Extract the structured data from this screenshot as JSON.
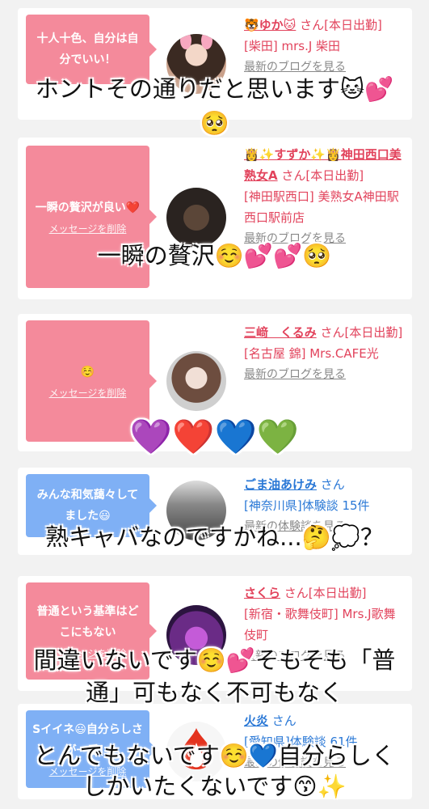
{
  "cards": [
    {
      "message": "十人十色、自分は自分でいい！",
      "bubble_color": "pink",
      "delete_label": "メッセージを削除",
      "name": "🐯ゆか🐱",
      "suffix": "さん[本日出勤]",
      "place": "[柴田] mrs.J 柴田",
      "blog_link": "最新のブログを見る",
      "name_color": "pink"
    },
    {
      "message": "一瞬の贅沢が良い❤️",
      "bubble_color": "pink",
      "delete_label": "メッセージを削除",
      "name": "👸✨すずか✨👸神田西口美熟女A",
      "suffix": "さん[本日出勤]",
      "place": "[神田駅西口] 美熟女A神田駅西口駅前店",
      "blog_link": "最新のブログを見る",
      "name_color": "pink"
    },
    {
      "message": "☺️",
      "bubble_color": "pink",
      "delete_label": "メッセージを削除",
      "name": "三﨑　くるみ",
      "suffix": "さん[本日出勤]",
      "place": "[名古屋 錦] Mrs.CAFE光",
      "blog_link": "最新のブログを見る",
      "name_color": "pink"
    },
    {
      "message": "みんな和気藹々してました😃",
      "bubble_color": "blue",
      "delete_label": "",
      "name": "ごま油あけみ",
      "suffix": "さん",
      "place": "[神奈川県]体験談 15件",
      "blog_link": "最新の体験談を見る",
      "name_color": "blue"
    },
    {
      "message": "普通という基準はどこにもない",
      "bubble_color": "pink",
      "delete_label": "メッセージを削除",
      "name": "さくら",
      "suffix": "さん[本日出勤]",
      "place": "[新宿・歌舞伎町] Mrs.J歌舞伎町",
      "blog_link": "最新のブログを見る",
      "name_color": "pink"
    },
    {
      "message": "Sイイネ😃自分らしさが一番！",
      "bubble_color": "blue",
      "delete_label": "メッセージを削除",
      "name": "火炎",
      "suffix": "さん",
      "place": "[愛知県]体験談 61件",
      "blog_link": "最新の体験談を見る",
      "name_color": "blue"
    }
  ],
  "overlays": [
    "ホントその通りだと思います🐱💕",
    "🥺",
    "一瞬の贅沢☺️💕💕🥺",
    "💜❤️💙💚",
    "熟キャバなのですかね...🤔💭？",
    "間違いないです☺️💕そもそも「普",
    "通」可もなく不可もなく",
    "とんでもないです☺️💙自分らしく",
    "しかいたくないです😙✨"
  ],
  "colors": {
    "pink_bubble": "#f48a9b",
    "blue_bubble": "#7fb0f5",
    "pink_text": "#e2435c",
    "blue_text": "#2a78d6"
  }
}
